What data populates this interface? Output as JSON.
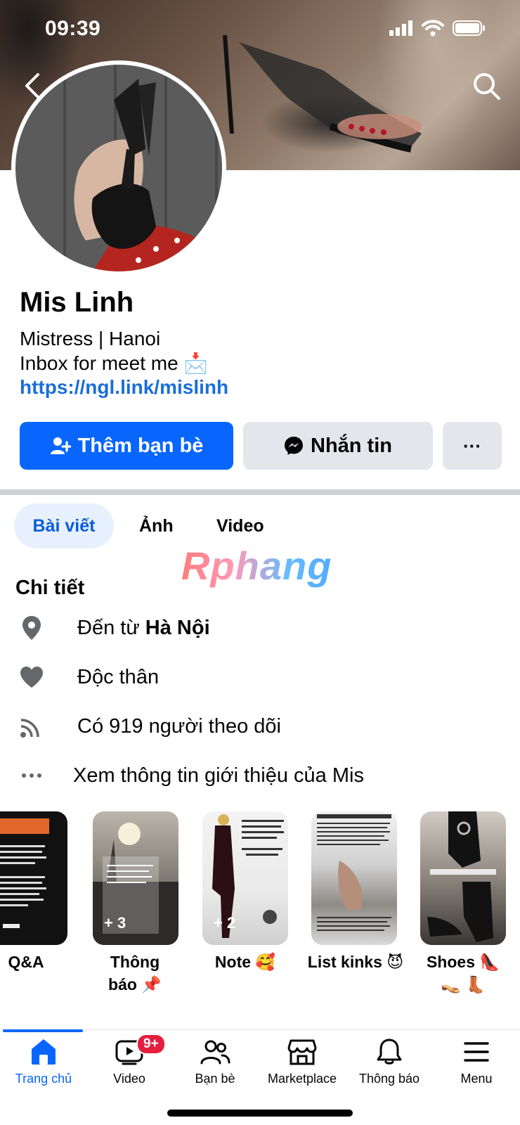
{
  "status_bar": {
    "time": "09:39",
    "icons": [
      "signal-icon",
      "wifi-icon",
      "battery-icon"
    ]
  },
  "header": {
    "back_icon": "chevron-left-icon",
    "search_icon": "search-icon"
  },
  "profile": {
    "name": "Mis Linh",
    "bio_line1": "Mistress | Hanoi",
    "bio_line2": "Inbox for meet me 📩",
    "link": "https://ngl.link/mislinh"
  },
  "actions": {
    "add_friend": "Thêm bạn bè",
    "message": "Nhắn tin",
    "more": "···"
  },
  "tabs": {
    "posts": "Bài viết",
    "photos": "Ảnh",
    "video": "Video"
  },
  "watermark": "Rphang",
  "details": {
    "title": "Chi tiết",
    "from_prefix": "Đến từ ",
    "from_place": "Hà Nội",
    "relationship": "Độc thân",
    "followers": "Có 919 người theo dõi",
    "see_more": "Xem thông tin giới thiệu của Mis"
  },
  "highlights": [
    {
      "label": "Q&A"
    },
    {
      "label": "Thông báo 📌",
      "count": "+ 3"
    },
    {
      "label": "Note 🥰",
      "count": "+ 2"
    },
    {
      "label": "List kinks 😈"
    },
    {
      "label": "Shoes 👠 👡 👢"
    }
  ],
  "bottom_nav": [
    {
      "label": "Trang chủ",
      "icon": "home-icon",
      "active": true
    },
    {
      "label": "Video",
      "icon": "video-icon",
      "badge": "9+"
    },
    {
      "label": "Bạn bè",
      "icon": "friends-icon"
    },
    {
      "label": "Marketplace",
      "icon": "marketplace-icon"
    },
    {
      "label": "Thông báo",
      "icon": "bell-icon"
    },
    {
      "label": "Menu",
      "icon": "menu-icon"
    }
  ],
  "colors": {
    "primary": "#0866ff",
    "link": "#1a6ed8",
    "tab_active_bg": "#e7f0fd",
    "badge": "#e41e3f"
  }
}
